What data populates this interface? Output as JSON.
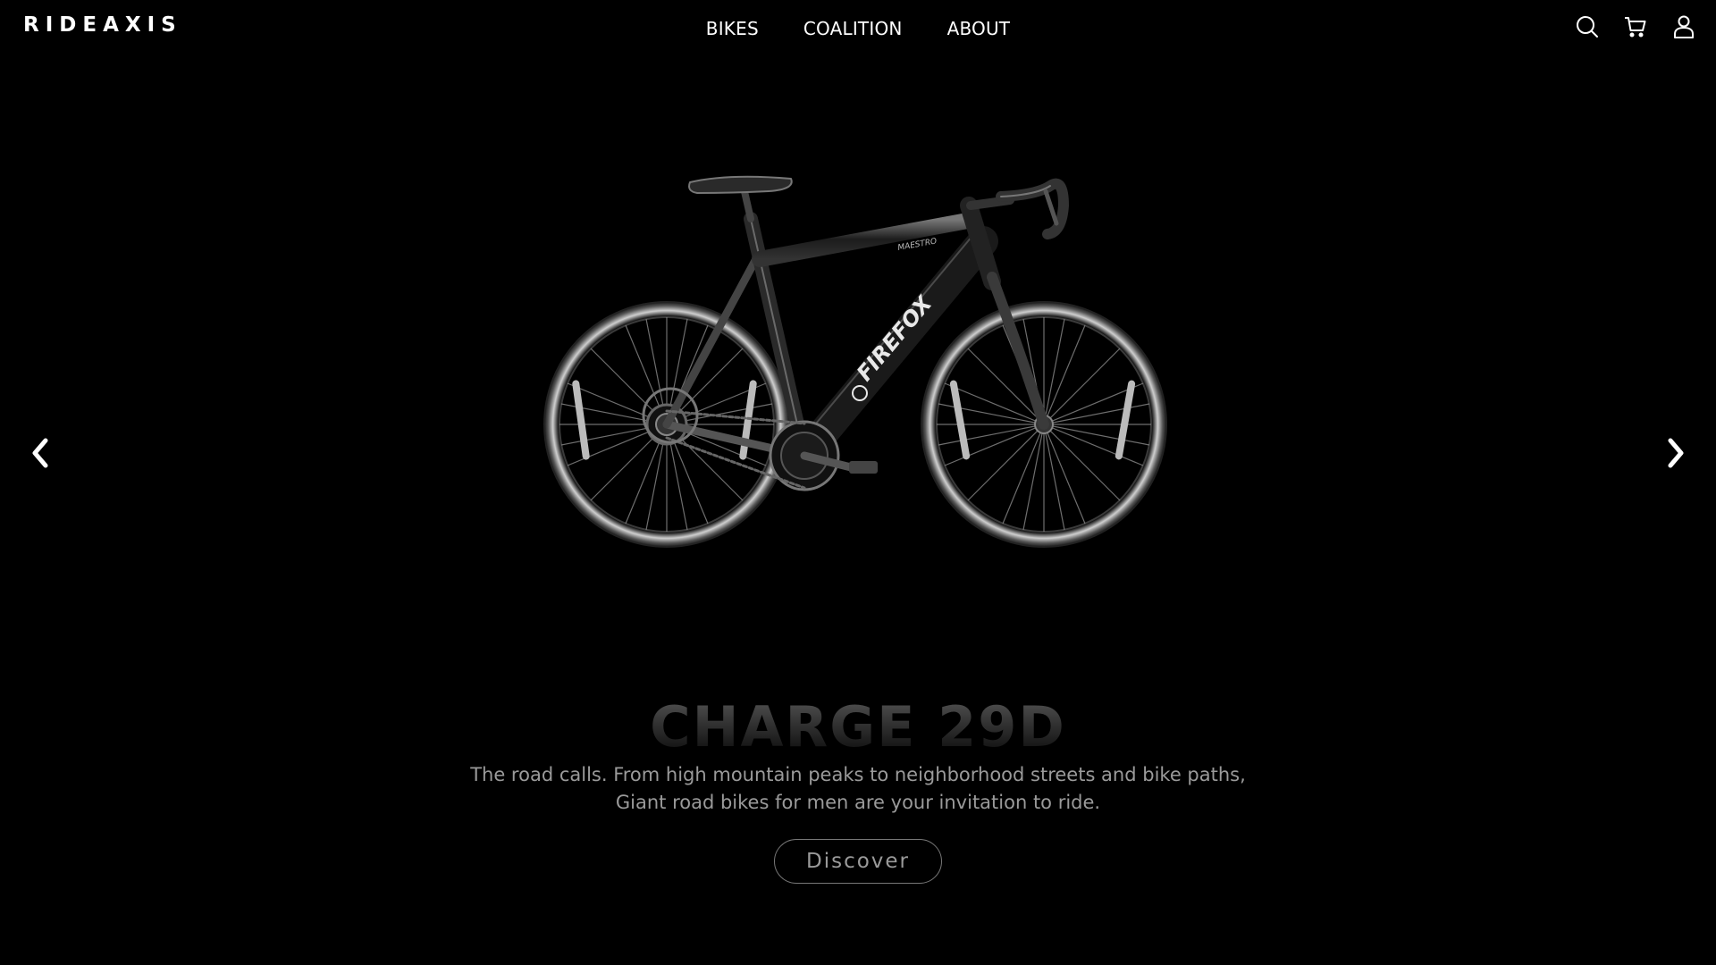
{
  "brand": {
    "logo": "RIDEAXIS"
  },
  "nav": {
    "items": [
      "BIKES",
      "COALITION",
      "ABOUT"
    ]
  },
  "header_icons": [
    "search-icon",
    "cart-icon",
    "user-icon"
  ],
  "hero": {
    "title": "CHARGE 29D",
    "description_line1": "The road calls. From high mountain peaks to neighborhood streets and bike paths,",
    "description_line2": "Giant road bikes for men are your invitation to ride.",
    "cta_label": "Discover",
    "bike_label": "FIREFOX",
    "bike_model_label": "MAESTRO"
  },
  "carousel": {
    "prev_icon": "chevron-left-icon",
    "next_icon": "chevron-right-icon"
  },
  "colors": {
    "background": "#000000",
    "text": "#ffffff",
    "muted": "#9a9a9a"
  }
}
